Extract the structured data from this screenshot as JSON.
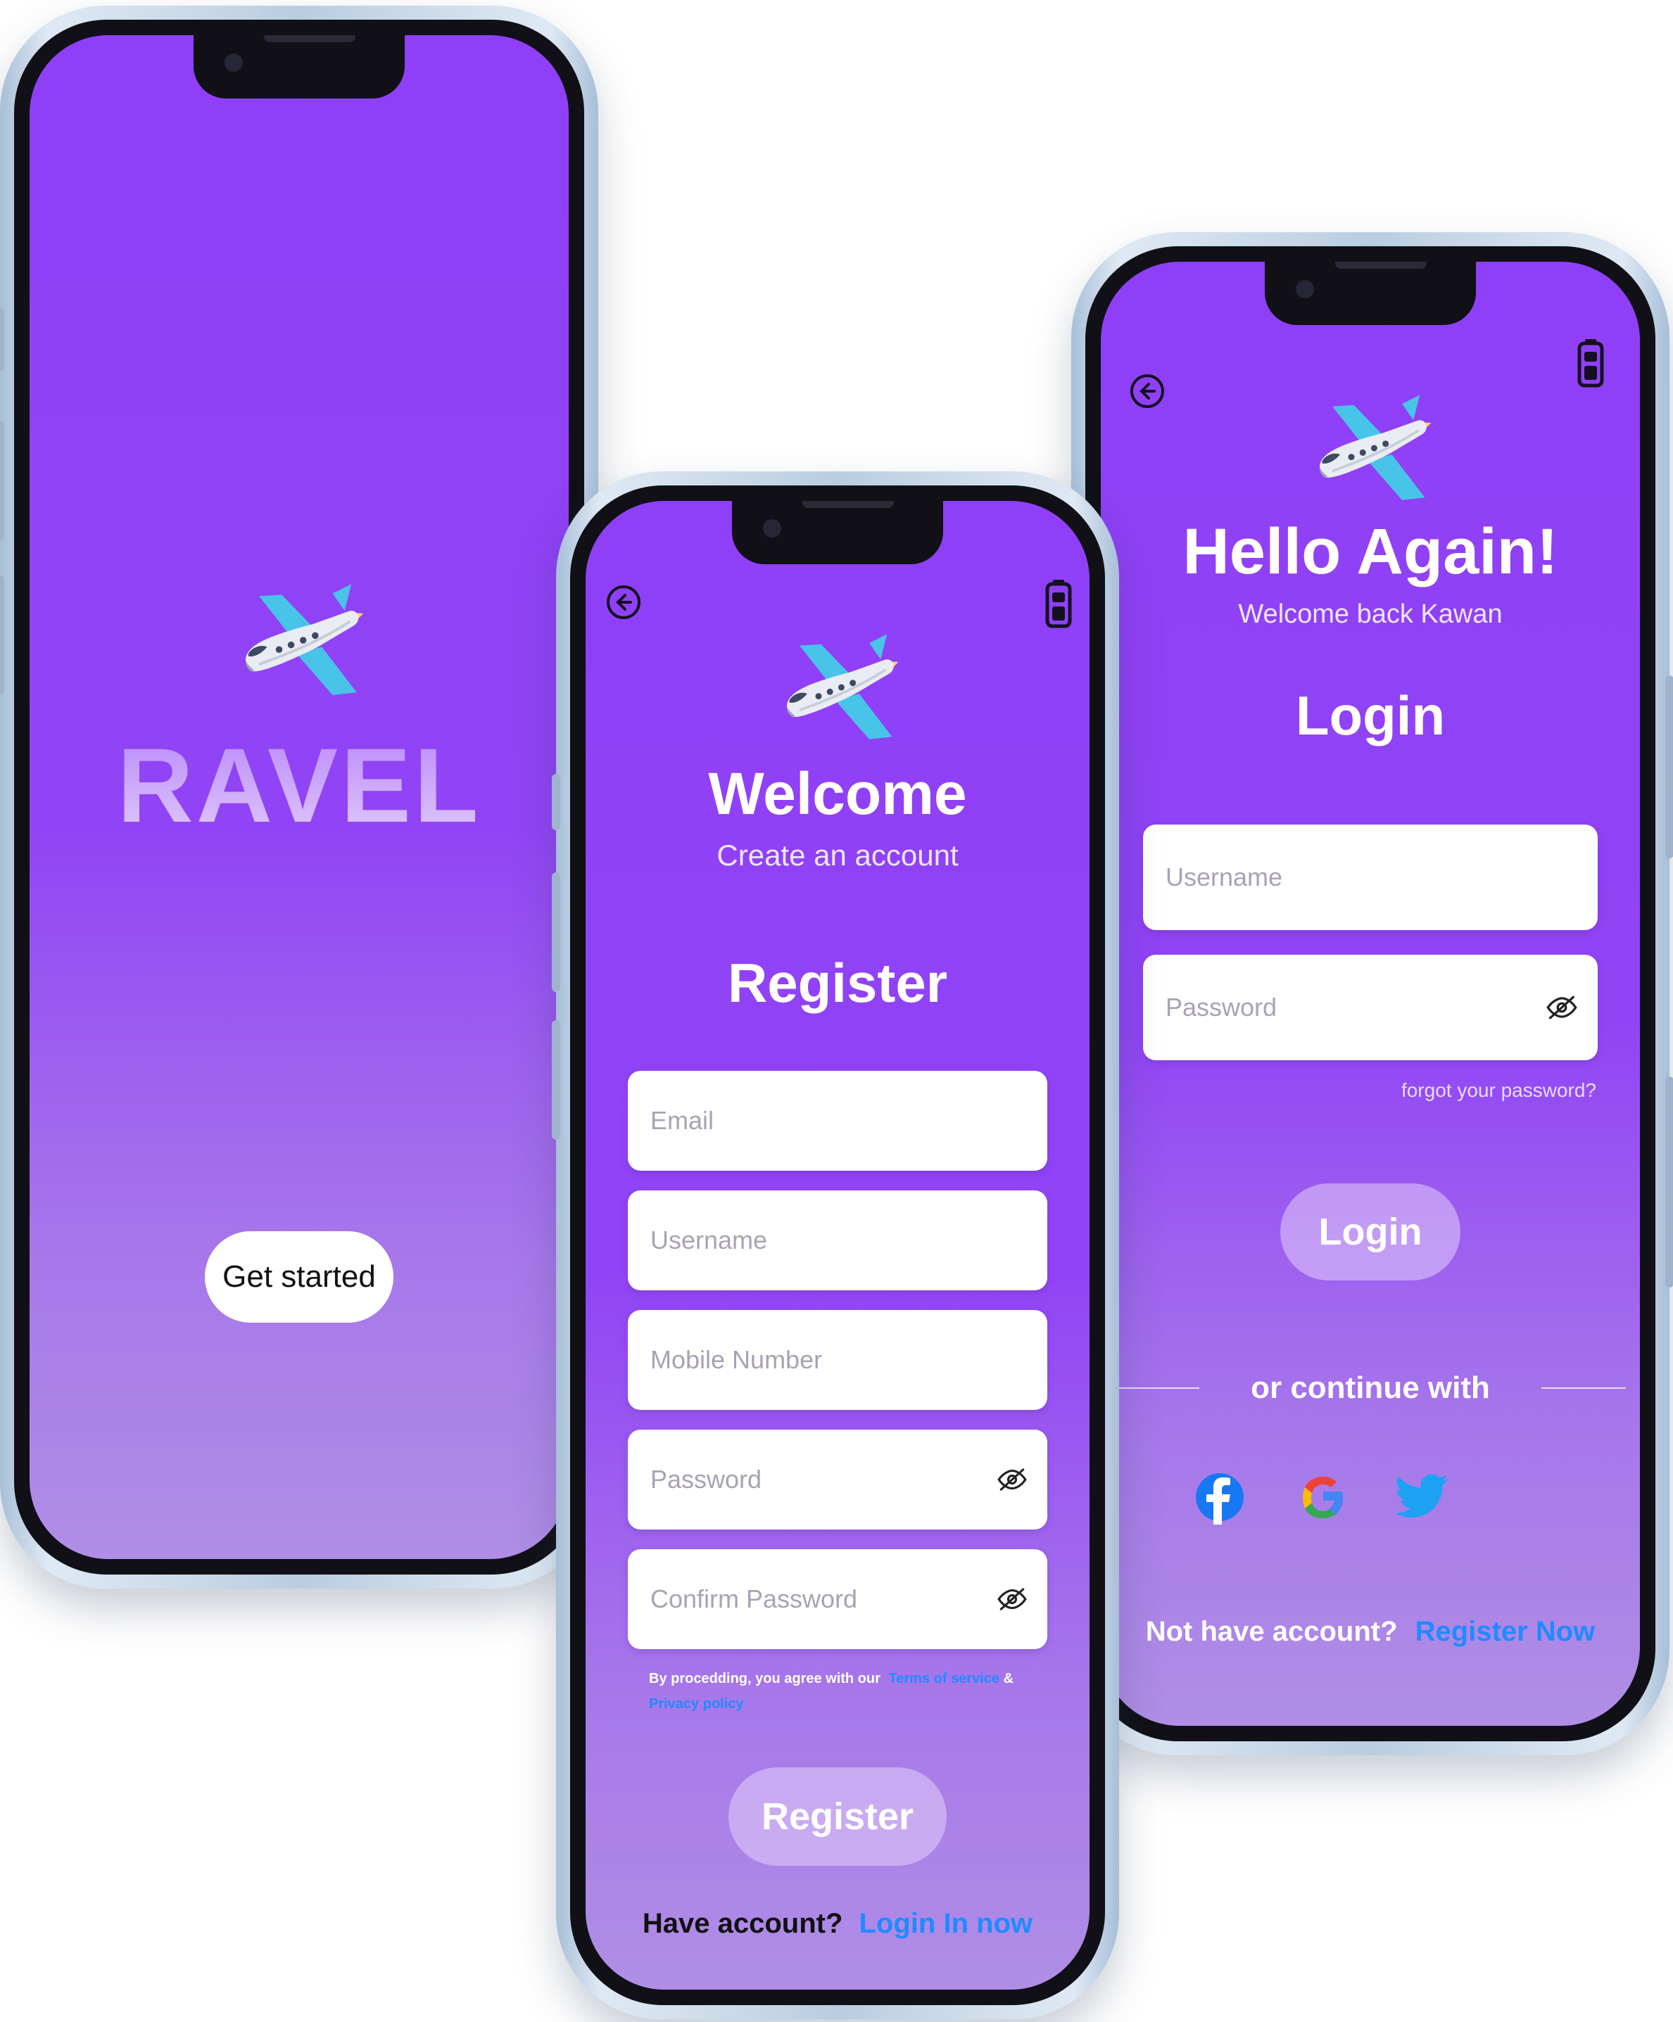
{
  "splash": {
    "brand": "RAVEL",
    "cta": "Get started"
  },
  "register": {
    "title": "Welcome",
    "subtitle": "Create an account",
    "heading": "Register",
    "fields": {
      "email": "Email",
      "username": "Username",
      "mobile": "Mobile Number",
      "password": "Password",
      "confirm": "Confirm Password"
    },
    "terms_prefix": "By procedding, you agree with our",
    "terms_link": "Terms of service",
    "terms_and": "&",
    "privacy_link": "Privacy policy",
    "submit": "Register",
    "footer_text": "Have account?",
    "footer_link": "Login In now"
  },
  "login": {
    "title": "Hello Again!",
    "subtitle": "Welcome back Kawan",
    "heading": "Login",
    "fields": {
      "username": "Username",
      "password": "Password"
    },
    "forgot": "forgot your password?",
    "submit": "Login",
    "divider": "or continue with",
    "social": [
      "facebook-icon",
      "google-icon",
      "twitter-icon"
    ],
    "footer_text": "Not have account?",
    "footer_link": "Register Now"
  },
  "colors": {
    "primary": "#8f3ff7",
    "link": "#1f8bff",
    "field": "#ffffff"
  }
}
